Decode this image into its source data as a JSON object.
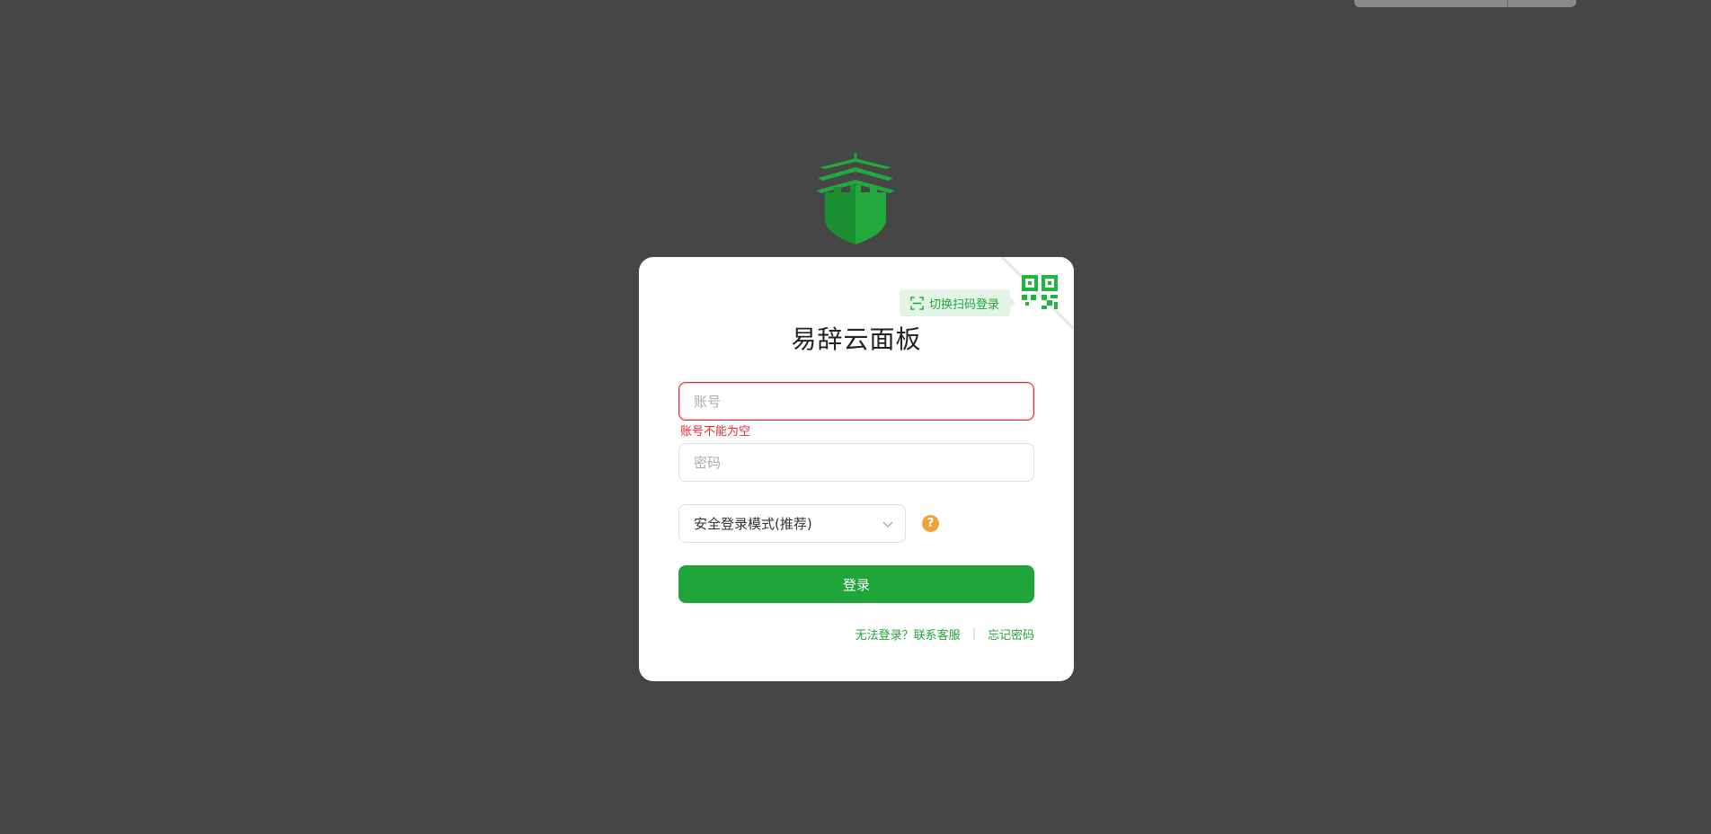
{
  "app": {
    "title": "易辞云面板"
  },
  "qr_switch": {
    "label": "切换扫码登录"
  },
  "form": {
    "account_placeholder": "账号",
    "account_error": "账号不能为空",
    "password_placeholder": "密码",
    "login_mode": "安全登录模式(推荐)",
    "help_symbol": "?",
    "submit_label": "登录"
  },
  "links": {
    "cannot_login": "无法登录？联系客服",
    "separator": "|",
    "forgot_password": "忘记密码"
  },
  "colors": {
    "accent": "#20a53a",
    "error": "#e5292f",
    "help": "#f0a33a",
    "background": "#464646"
  },
  "icons": [
    "castle-logo",
    "qr-code-icon",
    "scan-icon",
    "chevron-down-icon",
    "help-icon"
  ]
}
